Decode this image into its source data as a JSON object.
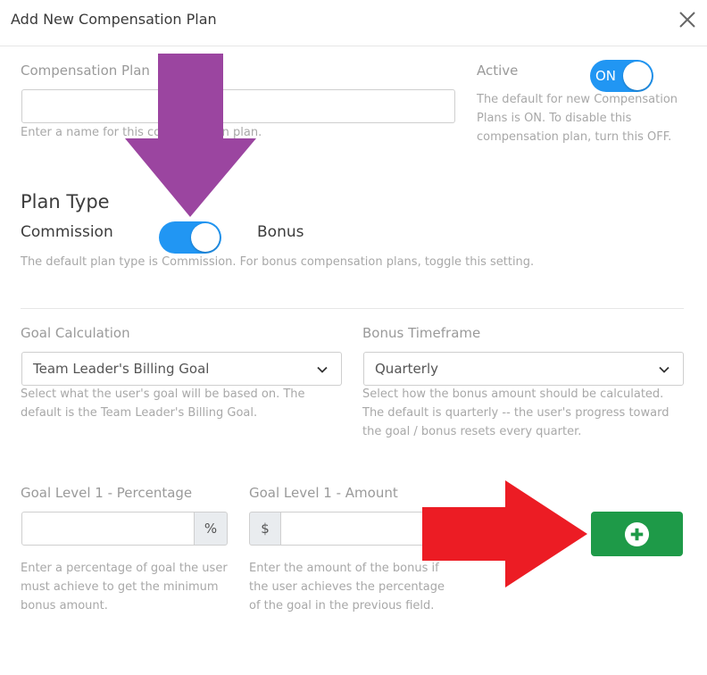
{
  "modal": {
    "title": "Add New Compensation Plan"
  },
  "plan_name": {
    "label": "Compensation Plan",
    "value": "",
    "placeholder": "",
    "help": "Enter a name for this compensation plan."
  },
  "active": {
    "label": "Active",
    "toggle_text": "ON",
    "state": "on",
    "help": "The default for new Compensation Plans is ON. To disable this compensation plan, turn this OFF."
  },
  "plan_type": {
    "title": "Plan Type",
    "option_left": "Commission",
    "option_right": "Bonus",
    "help": "The default plan type is Commission. For bonus compensation plans, toggle this setting."
  },
  "goal_calculation": {
    "label": "Goal Calculation",
    "selected": "Team Leader's Billing Goal",
    "help": "Select what the user's goal will be based on. The default is the Team Leader's Billing Goal."
  },
  "bonus_timeframe": {
    "label": "Bonus Timeframe",
    "selected": "Quarterly",
    "help": "Select how the bonus amount should be calculated. The default is quarterly -- the user's progress toward the goal / bonus resets every quarter."
  },
  "goal_percentage": {
    "label": "Goal Level 1 - Percentage",
    "value": "",
    "suffix": "%",
    "help": "Enter a percentage of goal the user must achieve to get the minimum bonus amount."
  },
  "goal_amount": {
    "label": "Goal Level 1 - Amount",
    "value": "",
    "prefix": "$",
    "help": "Enter the amount of the bonus if the user achieves the percentage of the goal in the previous field."
  },
  "colors": {
    "toggle_blue": "#2196f3",
    "add_button_green": "#1e9a48",
    "annotation_purple": "#9b45a0",
    "annotation_red": "#ec1c24"
  },
  "icons": {
    "close": "close-icon",
    "chevron": "chevron-down-icon",
    "add": "plus-circle-icon"
  }
}
